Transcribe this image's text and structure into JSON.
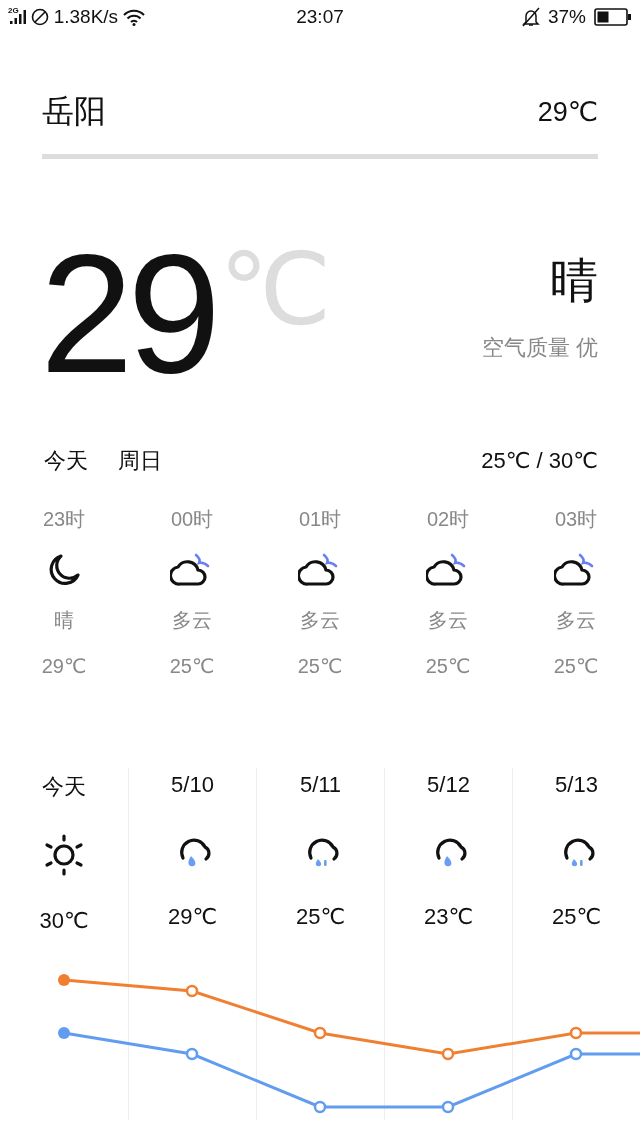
{
  "status_bar": {
    "network": "2G",
    "speed": "1.38K/s",
    "time": "23:07",
    "battery": "37%"
  },
  "city": {
    "name": "岳阳",
    "temp": "29℃"
  },
  "current": {
    "temp": "29",
    "unit": "℃",
    "condition": "晴",
    "air_quality": "空气质量 优"
  },
  "today": {
    "day": "今天",
    "weekday": "周日",
    "range": "25℃ / 30℃"
  },
  "hourly": [
    {
      "time": "23时",
      "kind": "moon",
      "condition": "晴",
      "temp": "29℃"
    },
    {
      "time": "00时",
      "kind": "cloudy-night",
      "condition": "多云",
      "temp": "25℃"
    },
    {
      "time": "01时",
      "kind": "cloudy-night",
      "condition": "多云",
      "temp": "25℃"
    },
    {
      "time": "02时",
      "kind": "cloudy-night",
      "condition": "多云",
      "temp": "25℃"
    },
    {
      "time": "03时",
      "kind": "cloudy-night",
      "condition": "多云",
      "temp": "25℃"
    }
  ],
  "daily": [
    {
      "date": "今天",
      "kind": "sunny",
      "temp": "30℃"
    },
    {
      "date": "5/10",
      "kind": "rain",
      "temp": "29℃"
    },
    {
      "date": "5/11",
      "kind": "light-rain",
      "temp": "25℃"
    },
    {
      "date": "5/12",
      "kind": "rain",
      "temp": "23℃"
    },
    {
      "date": "5/13",
      "kind": "light-rain",
      "temp": "25℃"
    }
  ]
}
